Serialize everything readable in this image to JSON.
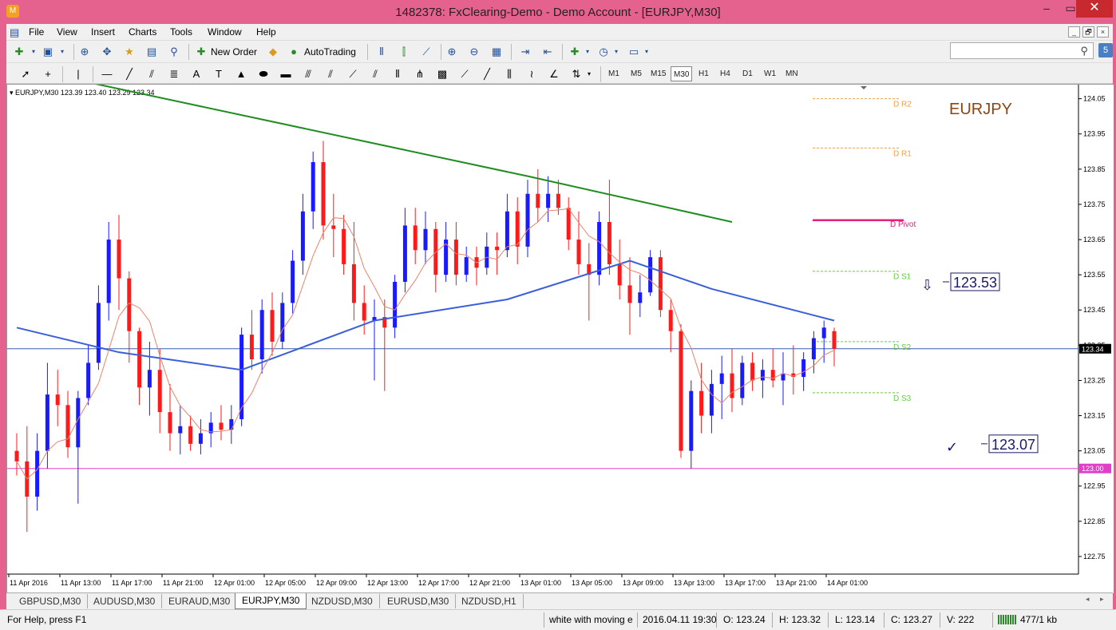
{
  "window": {
    "title": "1482378: FxClearing-Demo - Demo Account - [EURJPY,M30]",
    "minimize_glyph": "‒",
    "maximize_glyph": "▭",
    "close_glyph": "✕",
    "app_glyph": "M"
  },
  "menu": {
    "items": [
      "File",
      "View",
      "Insert",
      "Charts",
      "Tools",
      "Window",
      "Help"
    ],
    "mdi": [
      "_",
      "🗗",
      "×"
    ]
  },
  "toolbar": {
    "new_order_label": "New Order",
    "autotrading_label": "AutoTrading",
    "timeframes": [
      "M1",
      "M5",
      "M15",
      "M30",
      "H1",
      "H4",
      "D1",
      "W1",
      "MN"
    ],
    "active_timeframe": "M30",
    "search": {
      "value": "",
      "button_label": "5"
    }
  },
  "chart": {
    "info_line": "EURJPY,M30  123.39 123.40 123.29 123.34",
    "symbol_watermark": "EURJPY",
    "current_price_tag": "123.34",
    "hline_tag": "123.00",
    "annotations": [
      {
        "text": "123.53",
        "glyph": "⇩",
        "price": 123.53
      },
      {
        "text": "123.07",
        "glyph": "✓",
        "price": 123.07
      }
    ],
    "pivot_labels": [
      {
        "text": "D R2",
        "price": 124.05,
        "color": "#f0a040"
      },
      {
        "text": "D R1",
        "price": 123.91,
        "color": "#f0a040"
      },
      {
        "text": "D Pivot",
        "price": 123.705,
        "color": "#e0207a"
      },
      {
        "text": "D S1",
        "price": 123.56,
        "color": "#66cc44"
      },
      {
        "text": "D S2",
        "price": 123.36,
        "color": "#66cc44"
      },
      {
        "text": "D S3",
        "price": 123.215,
        "color": "#66cc44"
      }
    ],
    "price_ticks": [
      "124.05",
      "123.95",
      "123.85",
      "123.75",
      "123.65",
      "123.55",
      "123.45",
      "123.35",
      "123.25",
      "123.15",
      "123.05",
      "122.95",
      "122.85",
      "122.75"
    ],
    "time_ticks": [
      "11 Apr 2016",
      "11 Apr 13:00",
      "11 Apr 17:00",
      "11 Apr 21:00",
      "12 Apr 01:00",
      "12 Apr 05:00",
      "12 Apr 09:00",
      "12 Apr 13:00",
      "12 Apr 17:00",
      "12 Apr 21:00",
      "13 Apr 01:00",
      "13 Apr 05:00",
      "13 Apr 09:00",
      "13 Apr 13:00",
      "13 Apr 17:00",
      "13 Apr 21:00",
      "14 Apr 01:00"
    ],
    "colors": {
      "bull": "#1a1aff",
      "bear": "#ff1a1a",
      "doji": "#33cc33",
      "ma_long": "#1e8c1e",
      "ma_mid": "#3a5fd9",
      "ma_fast": "#e8836a",
      "current_price_line": "#3a5fb0",
      "hline": "#e040c8",
      "watermark": "#8b4513"
    }
  },
  "chart_data": {
    "type": "candlestick",
    "symbol": "EURJPY",
    "timeframe": "M30",
    "ylim": [
      122.7,
      124.09
    ],
    "last": {
      "open": 123.39,
      "high": 123.4,
      "low": 123.29,
      "close": 123.34
    },
    "candles": [
      [
        123.05,
        123.1,
        122.98,
        123.02
      ],
      [
        123.02,
        123.12,
        122.82,
        122.92
      ],
      [
        122.92,
        123.1,
        122.88,
        123.05
      ],
      [
        123.05,
        123.3,
        123.0,
        123.21
      ],
      [
        123.21,
        123.28,
        123.12,
        123.18
      ],
      [
        123.18,
        123.22,
        123.03,
        123.06
      ],
      [
        123.06,
        123.22,
        122.9,
        123.2
      ],
      [
        123.2,
        123.35,
        123.18,
        123.3
      ],
      [
        123.3,
        123.52,
        123.28,
        123.47
      ],
      [
        123.47,
        123.7,
        123.42,
        123.65
      ],
      [
        123.65,
        123.72,
        123.45,
        123.54
      ],
      [
        123.54,
        123.56,
        123.3,
        123.39
      ],
      [
        123.39,
        123.4,
        123.18,
        123.23
      ],
      [
        123.23,
        123.36,
        123.15,
        123.28
      ],
      [
        123.28,
        123.34,
        123.1,
        123.16
      ],
      [
        123.16,
        123.24,
        123.05,
        123.1
      ],
      [
        123.1,
        123.18,
        123.04,
        123.12
      ],
      [
        123.12,
        123.15,
        123.05,
        123.07
      ],
      [
        123.07,
        123.14,
        123.04,
        123.1
      ],
      [
        123.1,
        123.16,
        123.06,
        123.13
      ],
      [
        123.13,
        123.18,
        123.08,
        123.11
      ],
      [
        123.11,
        123.18,
        123.07,
        123.14
      ],
      [
        123.14,
        123.4,
        123.12,
        123.38
      ],
      [
        123.38,
        123.45,
        123.28,
        123.31
      ],
      [
        123.31,
        123.48,
        123.27,
        123.45
      ],
      [
        123.45,
        123.5,
        123.32,
        123.36
      ],
      [
        123.36,
        123.5,
        123.34,
        123.47
      ],
      [
        123.47,
        123.62,
        123.44,
        123.59
      ],
      [
        123.59,
        123.78,
        123.55,
        123.73
      ],
      [
        123.73,
        123.9,
        123.68,
        123.87
      ],
      [
        123.87,
        123.93,
        123.65,
        123.69
      ],
      [
        123.69,
        123.78,
        123.6,
        123.68
      ],
      [
        123.68,
        123.72,
        123.55,
        123.58
      ],
      [
        123.58,
        123.7,
        123.42,
        123.47
      ],
      [
        123.47,
        123.52,
        123.38,
        123.42
      ],
      [
        123.42,
        123.48,
        123.25,
        123.43
      ],
      [
        123.43,
        123.48,
        123.22,
        123.4
      ],
      [
        123.4,
        123.55,
        123.37,
        123.53
      ],
      [
        123.53,
        123.74,
        123.5,
        123.69
      ],
      [
        123.69,
        123.74,
        123.58,
        123.62
      ],
      [
        123.62,
        123.73,
        123.58,
        123.68
      ],
      [
        123.68,
        123.7,
        123.5,
        123.55
      ],
      [
        123.55,
        123.7,
        123.53,
        123.65
      ],
      [
        123.65,
        123.7,
        123.52,
        123.55
      ],
      [
        123.55,
        123.63,
        123.53,
        123.6
      ],
      [
        123.6,
        123.63,
        123.52,
        123.57
      ],
      [
        123.57,
        123.67,
        123.55,
        123.63
      ],
      [
        123.63,
        123.67,
        123.55,
        123.62
      ],
      [
        123.62,
        123.78,
        123.6,
        123.73
      ],
      [
        123.73,
        123.77,
        123.58,
        123.63
      ],
      [
        123.63,
        123.82,
        123.6,
        123.78
      ],
      [
        123.78,
        123.85,
        123.7,
        123.74
      ],
      [
        123.74,
        123.83,
        123.7,
        123.78
      ],
      [
        123.78,
        123.82,
        123.72,
        123.74
      ],
      [
        123.74,
        123.77,
        123.62,
        123.65
      ],
      [
        123.65,
        123.73,
        123.55,
        123.58
      ],
      [
        123.58,
        123.64,
        123.42,
        123.55
      ],
      [
        123.55,
        123.73,
        123.52,
        123.7
      ],
      [
        123.7,
        123.82,
        123.55,
        123.58
      ],
      [
        123.58,
        123.65,
        123.48,
        123.52
      ],
      [
        123.52,
        123.6,
        123.38,
        123.47
      ],
      [
        123.47,
        123.55,
        123.43,
        123.5
      ],
      [
        123.5,
        123.62,
        123.49,
        123.6
      ],
      [
        123.6,
        123.62,
        123.43,
        123.45
      ],
      [
        123.45,
        123.48,
        123.33,
        123.39
      ],
      [
        123.39,
        123.41,
        123.03,
        123.05
      ],
      [
        123.05,
        123.25,
        123.0,
        123.22
      ],
      [
        123.22,
        123.3,
        123.1,
        123.15
      ],
      [
        123.15,
        123.28,
        123.1,
        123.24
      ],
      [
        123.24,
        123.32,
        123.14,
        123.27
      ],
      [
        123.27,
        123.34,
        123.16,
        123.2
      ],
      [
        123.2,
        123.32,
        123.18,
        123.3
      ],
      [
        123.3,
        123.33,
        123.22,
        123.25
      ],
      [
        123.25,
        123.31,
        123.2,
        123.28
      ],
      [
        123.28,
        123.34,
        123.23,
        123.25
      ],
      [
        123.25,
        123.33,
        123.18,
        123.27
      ],
      [
        123.27,
        123.35,
        123.21,
        123.26
      ],
      [
        123.26,
        123.33,
        123.22,
        123.31
      ],
      [
        123.31,
        123.39,
        123.27,
        123.37
      ],
      [
        123.37,
        123.42,
        123.3,
        123.4
      ],
      [
        123.39,
        123.4,
        123.29,
        123.34
      ]
    ],
    "moving_averages": [
      {
        "color": "#1e8c1e",
        "values": [
          [
            0,
            124.14
          ],
          [
            50,
            123.83
          ],
          [
            70,
            123.7
          ]
        ]
      },
      {
        "color": "#3a5fd9",
        "values": [
          [
            0,
            123.4
          ],
          [
            10,
            123.33
          ],
          [
            22,
            123.28
          ],
          [
            35,
            123.42
          ],
          [
            48,
            123.48
          ],
          [
            60,
            123.59
          ],
          [
            68,
            123.51
          ],
          [
            80,
            123.42
          ]
        ]
      }
    ],
    "horizontal_lines": [
      123.0
    ],
    "current_price": 123.34
  },
  "tabs": {
    "items": [
      "GBPUSD,M30",
      "AUDUSD,M30",
      "EURAUD,M30",
      "EURJPY,M30",
      "NZDUSD,M30",
      "EURUSD,M30",
      "NZDUSD,H1"
    ],
    "active": "EURJPY,M30"
  },
  "status": {
    "help": "For Help, press F1",
    "profile": "white with moving e",
    "datetime": "2016.04.11 19:30",
    "open": "O: 123.24",
    "high": "H: 123.32",
    "low": "L: 123.14",
    "close": "C: 123.27",
    "volume": "V: 222",
    "traffic": "477/1 kb"
  }
}
